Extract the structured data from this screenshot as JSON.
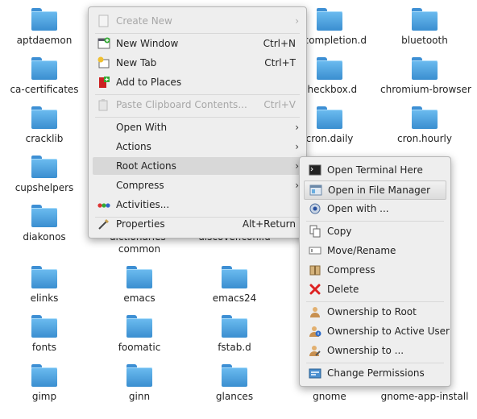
{
  "files": [
    {
      "name": "aptdaemon"
    },
    {
      "name": "ca-certificates"
    },
    {
      "name": "cracklib"
    },
    {
      "name": "cupshelpers"
    },
    {
      "name": "diakonos"
    },
    {
      "name": "dictionaries-"
    },
    {
      "name": "common"
    },
    {
      "name": "discover.conf.d"
    },
    {
      "name": "elinks"
    },
    {
      "name": "emacs"
    },
    {
      "name": "emacs24"
    },
    {
      "name": "fonts"
    },
    {
      "name": "foomatic"
    },
    {
      "name": "fstab.d"
    },
    {
      "name": "gimp"
    },
    {
      "name": "ginn"
    },
    {
      "name": "glances"
    },
    {
      "name": "gnome"
    },
    {
      "name": "gnome-app-install"
    },
    {
      "name": "h_completion.d"
    },
    {
      "name": "bluetooth"
    },
    {
      "name": "checkbox.d"
    },
    {
      "name": "chromium-browser"
    },
    {
      "name": "cron.daily"
    },
    {
      "name": "cron.hourly"
    }
  ],
  "context_menu": {
    "items": [
      {
        "label": "Create New",
        "icon": "create-new-icon"
      },
      {
        "label": "New Window",
        "shortcut": "Ctrl+N",
        "icon": "new-window-icon"
      },
      {
        "label": "New Tab",
        "shortcut": "Ctrl+T",
        "icon": "new-tab-icon"
      },
      {
        "label": "Add to Places",
        "icon": "add-places-icon"
      },
      {
        "label": "Paste Clipboard Contents...",
        "shortcut": "Ctrl+V",
        "icon": "paste-icon"
      },
      {
        "label": "Open With"
      },
      {
        "label": "Actions"
      },
      {
        "label": "Root Actions"
      },
      {
        "label": "Compress"
      },
      {
        "label": "Activities...",
        "icon": "activities-icon"
      },
      {
        "label": "Properties",
        "shortcut": "Alt+Return",
        "icon": "properties-icon"
      }
    ]
  },
  "root_actions_menu": {
    "items": [
      {
        "label": "Open Terminal Here",
        "icon": "terminal-icon"
      },
      {
        "label": "Open in File Manager",
        "icon": "file-manager-icon"
      },
      {
        "label": "Open with ...",
        "icon": "open-with-icon"
      },
      {
        "label": "Copy",
        "icon": "copy-icon"
      },
      {
        "label": "Move/Rename",
        "icon": "rename-icon"
      },
      {
        "label": "Compress",
        "icon": "compress-icon"
      },
      {
        "label": "Delete",
        "icon": "delete-icon"
      },
      {
        "label": "Ownership to Root",
        "icon": "user-root-icon"
      },
      {
        "label": "Ownership to Active User",
        "icon": "user-active-icon"
      },
      {
        "label": "Ownership to ...",
        "icon": "user-edit-icon"
      },
      {
        "label": "Change Permissions",
        "icon": "permissions-icon"
      }
    ]
  }
}
